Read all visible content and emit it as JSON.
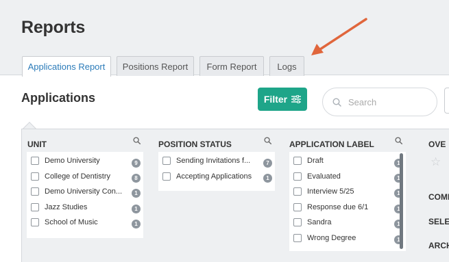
{
  "page": {
    "title": "Reports"
  },
  "tabs": [
    {
      "label": "Applications Report",
      "active": true
    },
    {
      "label": "Positions Report",
      "active": false
    },
    {
      "label": "Form Report",
      "active": false
    },
    {
      "label": "Logs",
      "active": false
    }
  ],
  "section": {
    "title": "Applications"
  },
  "filter": {
    "label": "Filter"
  },
  "search": {
    "placeholder": "Search"
  },
  "columns": {
    "unit": {
      "title": "UNIT",
      "items": [
        {
          "label": "Demo University",
          "count": "9"
        },
        {
          "label": "College of Dentistry",
          "count": "8"
        },
        {
          "label": "Demo University Con...",
          "count": "1"
        },
        {
          "label": "Jazz Studies",
          "count": "1"
        },
        {
          "label": "School of Music",
          "count": "1"
        }
      ]
    },
    "position_status": {
      "title": "POSITION STATUS",
      "items": [
        {
          "label": "Sending Invitations f...",
          "count": "7"
        },
        {
          "label": "Accepting Applications",
          "count": "1"
        }
      ]
    },
    "application_label": {
      "title": "APPLICATION LABEL",
      "items": [
        {
          "label": "Draft",
          "count": "1"
        },
        {
          "label": "Evaluated",
          "count": "1"
        },
        {
          "label": "Interview 5/25",
          "count": "1"
        },
        {
          "label": "Response due 6/1",
          "count": "1"
        },
        {
          "label": "Sandra",
          "count": "1"
        },
        {
          "label": "Wrong Degree",
          "count": "1"
        }
      ]
    },
    "right": {
      "overall": "OVE",
      "comments": "COMI",
      "select": "SELE",
      "archive": "ARCH"
    }
  },
  "colors": {
    "accent": "#1ea589",
    "tab_active_text": "#2b7bb9",
    "arrow": "#e0663c",
    "badge": "#8e969e"
  }
}
